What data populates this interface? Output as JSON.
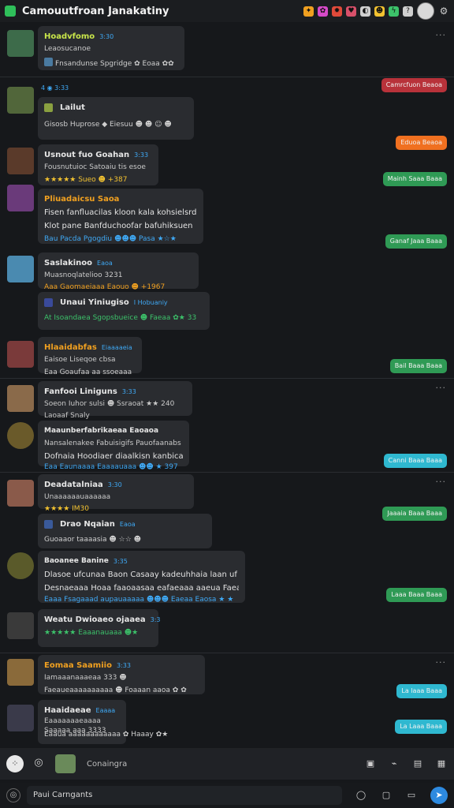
{
  "app": {
    "title": "Camouutfroan Janakatiny",
    "top_icons": [
      {
        "name": "trophy-icon",
        "color": "#f0a020",
        "glyph": "✦"
      },
      {
        "name": "gift-icon",
        "color": "#d64ac8",
        "glyph": "✿"
      },
      {
        "name": "fire-icon",
        "color": "#e04a3a",
        "glyph": "✹"
      },
      {
        "name": "heart-icon",
        "color": "#d8506a",
        "glyph": "♥"
      },
      {
        "name": "globe-icon",
        "color": "#cfcfcf",
        "glyph": "◐"
      },
      {
        "name": "smile-icon",
        "color": "#f2c230",
        "glyph": "☻"
      },
      {
        "name": "bolt-icon",
        "color": "#3cc26a",
        "glyph": "ϟ"
      },
      {
        "name": "info-icon",
        "color": "#cfcfcf",
        "glyph": "?"
      }
    ]
  },
  "messages": [
    {
      "name": "Hoadvfomo",
      "name_color": "#c9e64a",
      "time": "3:30",
      "lines": [
        "Leaosucanoe"
      ],
      "reactions": "Fnsandunse Spgridge  ✿  Eoaa  ✿✿",
      "avatar_color": "#3d6b4a"
    },
    {
      "name": "Lailut",
      "name_color": "#e6e6e6",
      "time": "",
      "lines": [],
      "reactions": "Gisosb Huprose  ◆  Eiesuu  ☻ ☻ ☺  ☻",
      "avatar_color": "#51663a",
      "header": "4  ◉  3:33"
    },
    {
      "name": "Usnout fuo Goahan",
      "name_color": "#e6e6e6",
      "time": "3:33",
      "lines": [
        "Fousnutuioc Satoaiu tis esoe"
      ],
      "reactions": "★★★★★ Sueo  ☻ +387",
      "avatar_color": "#5a3a2a"
    },
    {
      "name": "Pliuadaicsu Saoa",
      "name_color": "#f0a020",
      "time": "",
      "lines": [
        "Fisen fanfluacilas kloon  kala  kohsielsrdoan",
        "Klot pane Banfduchoofar bafuhiksuen"
      ],
      "reactions": "Bau  Pacda Pgogdiu  ☻☻☻  Pasa  ★☆★",
      "avatar_color": "#6a3a7a"
    },
    {
      "name": "Saslakinoo",
      "name_color": "#e6e6e6",
      "time": "Eaoa",
      "lines": [
        "Muasnoqlatelioo 3231",
        "Aaa Gaomaeiaaa Eaouo   ☻ +1967"
      ],
      "reactions": "",
      "avatar_color": "#4a8ab0"
    },
    {
      "name": "Unaui Yiniugiso",
      "name_color": "#e6e6e6",
      "time": "I Hobuaniy",
      "lines": [],
      "reactions": "At  Isoandaea Sgopsbueice  ☻  Faeaa  ✿★ 33",
      "avatar_color": "#3a4a7a"
    },
    {
      "name": "Hlaaidabfas",
      "name_color": "#f0a020",
      "time": "Eiaaaaeia",
      "lines": [
        "Eaisoe Liseqoe cbsa"
      ],
      "reactions": "Eaa  Goaufaa aa  ssoeaaa",
      "avatar_color": "#7a3a3a"
    },
    {
      "name": "Fanfooi Liniguns",
      "name_color": "#e6e6e6",
      "time": "3:33",
      "lines": [
        "Soeon Iuhor sulsi   ☻  Ssraoat  ★★ 240"
      ],
      "reactions": "Laoaaf Snaly",
      "avatar_color": "#8a6a4a"
    },
    {
      "name": "Maaunberfabrikaeaa  Eaoaoa",
      "name_color": "#e6e6e6",
      "time": "",
      "lines": [
        "Nansalenakee Fabuisigifs Pauofaanabs Kieaao",
        "Dofnaia Hoodiaer diaalkisn kanbican."
      ],
      "reactions": "Eaa  Eaunaaaa Eaaaauaaa  ☻☻ ★ 397",
      "avatar_color": "#6a5a2a"
    },
    {
      "name": "Deadatalniaa",
      "name_color": "#e6e6e6",
      "time": "3:30",
      "lines": [
        "Unaaaaaauaaaaaa"
      ],
      "reactions": "★★★★  IM30",
      "avatar_color": "#8a5a4a"
    },
    {
      "name": "Drao Nqaian",
      "name_color": "#e6e6e6",
      "time": "Eaoa",
      "lines": [],
      "reactions": "Guoaaor taaaasia  ☻  ☆☆  ☻",
      "avatar_color": "#3a5a9a"
    },
    {
      "name": "Baoanee Banine",
      "name_color": "#e6e6e6",
      "time": "3:35",
      "lines": [
        "Dlasoe ufcunaa Baon Casaay kadeuhhaia  laan uf laeaa",
        "Desnaeaaa Hoaa  faaoaasaa eafaeaaa  aaeua  Faeaaa"
      ],
      "reactions": "Eaaa  Fsagaaad aupauaaaaa  ☻☻☻  Eaeaa Eaosa  ★ ★",
      "avatar_color": "#5a5a2a"
    },
    {
      "name": "Weatu Dwioaeo ojaaea",
      "name_color": "#e6e6e6",
      "time": "3:3",
      "lines": [],
      "reactions": "★★★★★  Eaaanauaaa  ☻★",
      "avatar_color": "#3a3a3a"
    },
    {
      "name": "Eomaa Saamiio",
      "name_color": "#f0a020",
      "time": "3:33",
      "lines": [
        "Iamaaanaaaeaa 333  ☻"
      ],
      "reactions": "Faeaueaaaaaaaaaa  ☻  Foaaan aaoa  ✿ ✿",
      "avatar_color": "#8a6a3a"
    },
    {
      "name": "Haaidaeae",
      "name_color": "#e6e6e6",
      "time": "Eaaaa",
      "lines": [
        "Eaaaaaaaeaaaa",
        "Saaaaa aaa 3333"
      ],
      "reactions": "Eaaua aaaaaaaaaaaa  ✿  Haaay  ✿★",
      "avatar_color": "#3a3a4a"
    }
  ],
  "badges": [
    {
      "text": "Camrcfuon Beaoa",
      "color": "#b8323a"
    },
    {
      "text": "Eduoa Beaoa",
      "color": "#f07020"
    },
    {
      "text": "Mainh Saaa Baaa",
      "color": "#2f9a55"
    },
    {
      "text": "Ganaf Jaaa Baaa",
      "color": "#2f9a55"
    },
    {
      "text": "Bail Baaa Baaa",
      "color": "#2f9a55"
    },
    {
      "text": "Canni Baaa Baaa",
      "color": "#2fb8d0"
    },
    {
      "text": "Jaaaia Baaa Baaa",
      "color": "#2f9a55"
    },
    {
      "text": "Laaa Baaa Baaa",
      "color": "#2f9a55"
    },
    {
      "text": "La laaa Baaa",
      "color": "#2fb8d0"
    },
    {
      "text": "La Laaa Baaa",
      "color": "#2fb8d0"
    }
  ],
  "composer": {
    "placeholder": "Conaingra"
  },
  "bottombar": {
    "input_text": "Paui Carngants"
  }
}
